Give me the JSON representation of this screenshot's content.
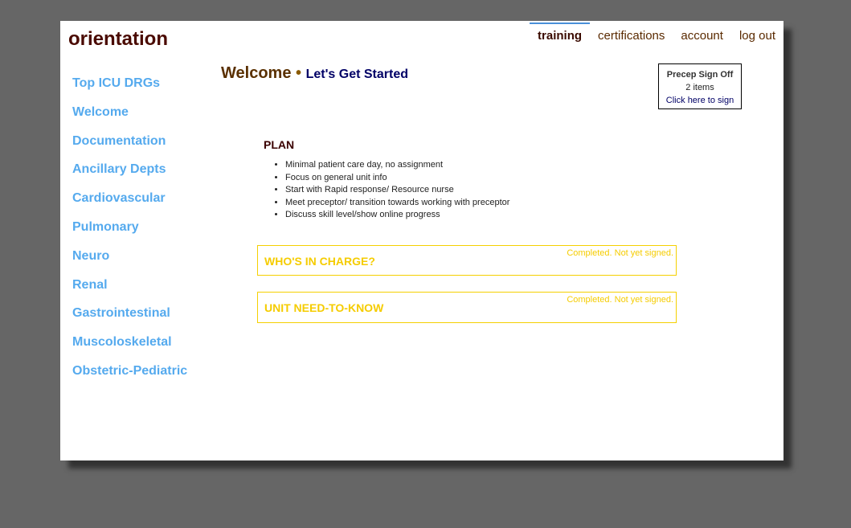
{
  "app": {
    "logo": "orientation"
  },
  "nav": [
    {
      "label": "training",
      "active": true
    },
    {
      "label": "certifications"
    },
    {
      "label": "account"
    },
    {
      "label": "log out"
    }
  ],
  "sidebar": [
    "Top ICU DRGs",
    "Welcome",
    "Documentation",
    "Ancillary Depts",
    "Cardiovascular",
    "Pulmonary",
    "Neuro",
    "Renal",
    "Gastrointestinal",
    "Muscoloskeletal",
    "Obstetric-Pediatric"
  ],
  "header": {
    "title": "Welcome",
    "separator": "•",
    "subtitle": "Let's Get Started"
  },
  "signoff": {
    "title": "Precep Sign Off",
    "count": "2 items",
    "pre": "Click ",
    "link": "here",
    "post": " to sign"
  },
  "plan": {
    "heading": "PLAN",
    "items": [
      "Minimal patient care day, no assignment",
      "Focus on general unit info",
      "Start with Rapid response/ Resource nurse",
      "Meet preceptor/ transition towards working with preceptor",
      "Discuss skill level/show online progress"
    ]
  },
  "sections": [
    {
      "title": "WHO'S IN CHARGE?",
      "status": "Completed. Not yet signed."
    },
    {
      "title": "UNIT NEED-TO-KNOW",
      "status": "Completed. Not yet signed."
    }
  ]
}
